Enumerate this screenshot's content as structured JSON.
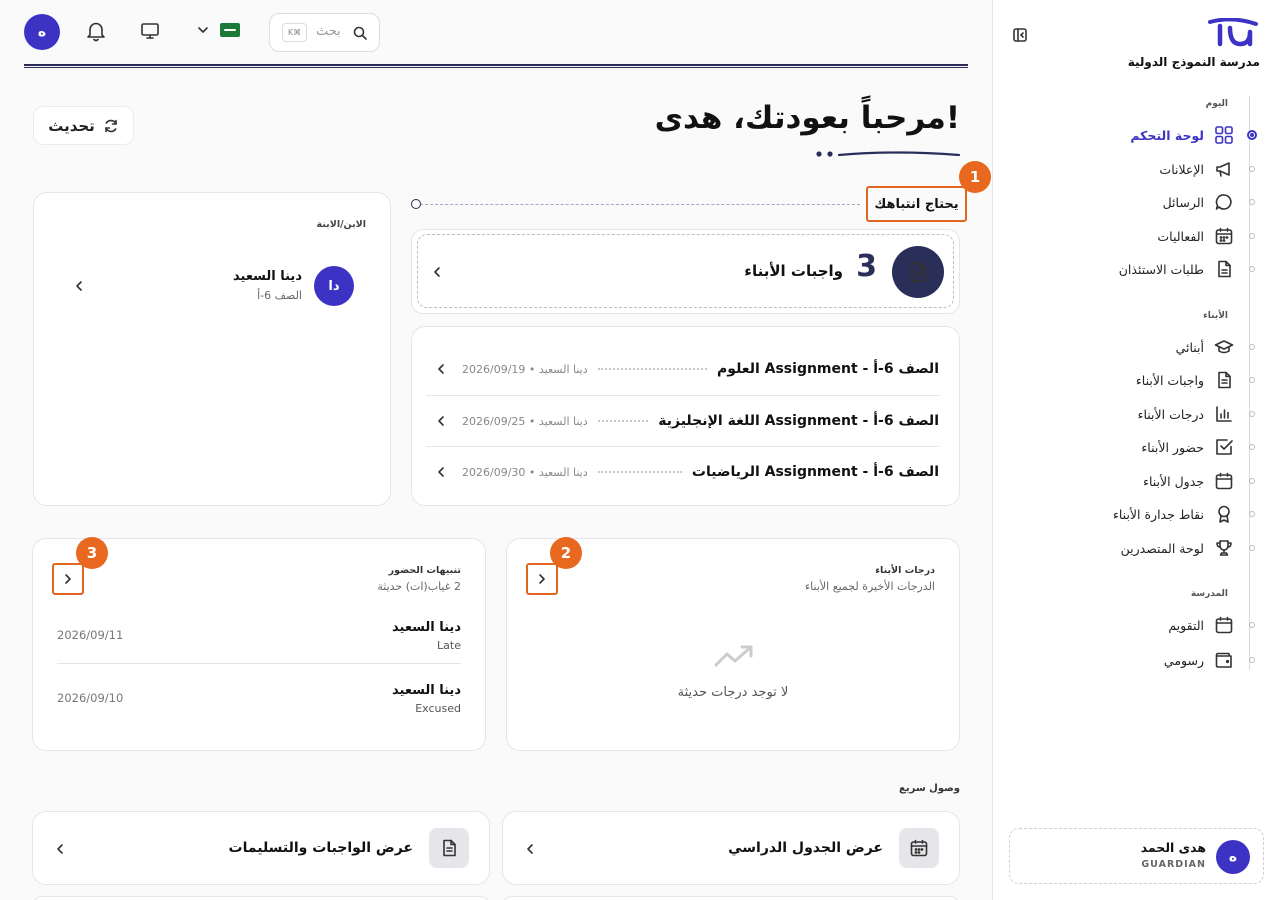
{
  "school_name": "مدرسة النموذج الدولية",
  "user": {
    "initial": "ه",
    "name": "هدى الحمد",
    "role": "GUARDIAN"
  },
  "nav": {
    "sections": [
      {
        "label": "اليوم"
      },
      {
        "label": "الأبناء"
      },
      {
        "label": "المدرسة"
      }
    ],
    "items": [
      {
        "label": "لوحة التحكم",
        "icon": "dashboard-icon"
      },
      {
        "label": "الإعلانات",
        "icon": "megaphone-icon"
      },
      {
        "label": "الرسائل",
        "icon": "chat-icon"
      },
      {
        "label": "الفعاليات",
        "icon": "calendar-grid-icon"
      },
      {
        "label": "طلبات الاستئذان",
        "icon": "document-icon"
      },
      {
        "label": "أبنائي",
        "icon": "graduation-cap-icon"
      },
      {
        "label": "واجبات الأبناء",
        "icon": "file-text-icon"
      },
      {
        "label": "درجات الأبناء",
        "icon": "bar-chart-icon"
      },
      {
        "label": "حضور الأبناء",
        "icon": "check-square-icon"
      },
      {
        "label": "جدول الأبناء",
        "icon": "calendar-icon"
      },
      {
        "label": "نقاط جدارة الأبناء",
        "icon": "award-icon"
      },
      {
        "label": "لوحة المتصدرين",
        "icon": "trophy-icon"
      },
      {
        "label": "التقويم",
        "icon": "calendar-icon"
      },
      {
        "label": "رسومي",
        "icon": "wallet-icon"
      }
    ]
  },
  "topbar": {
    "avatar_initial": "ه",
    "search_placeholder": "بحث",
    "shortcut": "K⌘"
  },
  "welcome": "مرحباً بعودتك، هدى!",
  "refresh_label": "تحديث",
  "attention": {
    "title": "يحتاج انتباهك",
    "homework_count": "3",
    "homework_title": "واجبات الأبناء",
    "assignments": [
      {
        "title": "العلوم Assignment - الصف 6-أ",
        "meta": "دينا السعيد • 2026/09/19"
      },
      {
        "title": "اللغة الإنجليزية Assignment - الصف 6-أ",
        "meta": "دينا السعيد • 2026/09/25"
      },
      {
        "title": "الرياضيات Assignment - الصف 6-أ",
        "meta": "دينا السعيد • 2026/09/30"
      }
    ]
  },
  "child_card": {
    "header": "الابن/الابنة",
    "initials": "دا",
    "name": "دينا السعيد",
    "class": "الصف 6-أ"
  },
  "grades": {
    "title": "درجات الأبناء",
    "subtitle": "الدرجات الأخيرة لجميع الأبناء",
    "empty": "لا توجد درجات حديثة"
  },
  "attendance": {
    "title": "تنبيهات الحضور",
    "subtitle": "2 غياب(ات) حديثة",
    "rows": [
      {
        "name": "دينا السعيد",
        "status": "Late",
        "date": "2026/09/11"
      },
      {
        "name": "دينا السعيد",
        "status": "Excused",
        "date": "2026/09/10"
      }
    ]
  },
  "badges": [
    "1",
    "2",
    "3"
  ],
  "quick": {
    "title": "وصول سريع",
    "items": [
      {
        "label": "عرض الجدول الدراسي",
        "icon": "calendar-icon"
      },
      {
        "label": "عرض الواجبات والتسليمات",
        "icon": "file-text-icon"
      }
    ]
  },
  "colors": {
    "accent": "#3c33c4",
    "navy": "#2a2f5a",
    "highlight": "#e8681f"
  }
}
